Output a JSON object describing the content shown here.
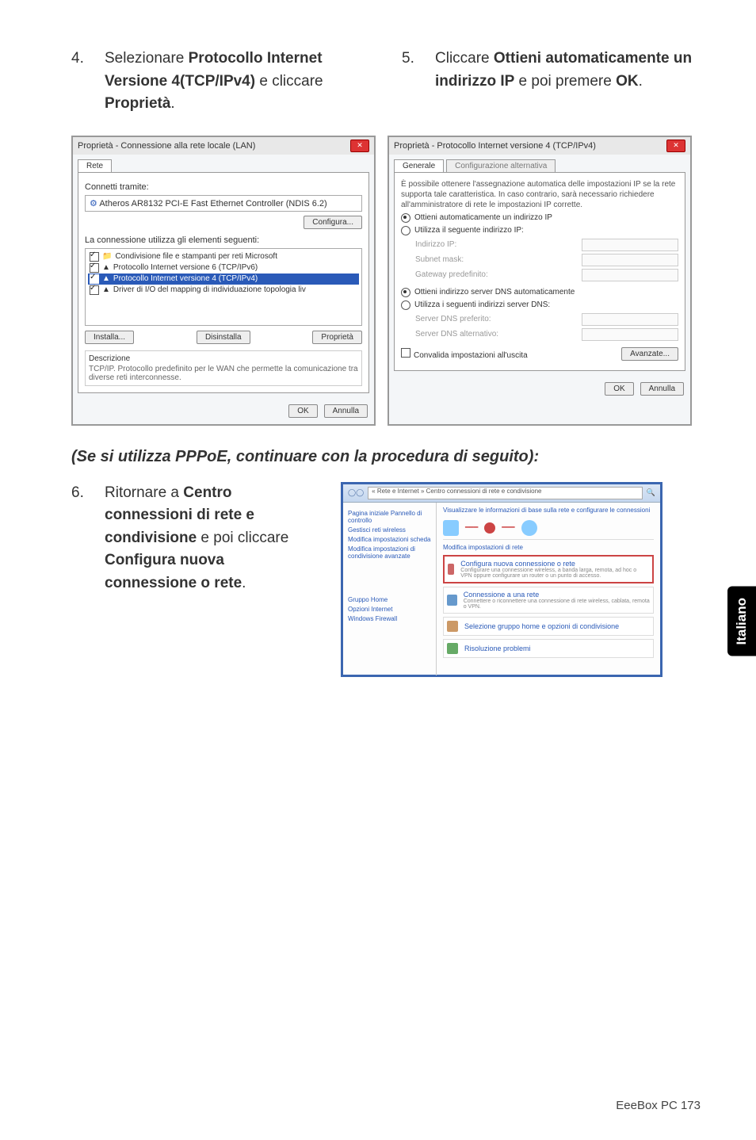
{
  "steps": {
    "s4": {
      "num": "4.",
      "text_pre": "Selezionare ",
      "b1": "Protocollo Internet Versione 4(TCP/IPv4)",
      "text_mid": " e cliccare ",
      "b2": "Proprietà",
      "text_end": "."
    },
    "s5": {
      "num": "5.",
      "text_pre": "Cliccare ",
      "b1": "Ottieni automaticamente un indirizzo IP",
      "text_mid": " e poi premere ",
      "b2": "OK",
      "text_end": "."
    },
    "s6": {
      "num": "6.",
      "text_pre": "Ritornare a ",
      "b1": "Centro connessioni di rete e condivisione",
      "text_mid": " e poi cliccare ",
      "b2": "Configura nuova connessione o rete",
      "text_end": "."
    }
  },
  "pppoe": "(Se si utilizza PPPoE, continuare con la procedura di seguito):",
  "dlg1": {
    "title": "Proprietà - Connessione alla rete locale (LAN)",
    "tab": "Rete",
    "connect_lbl": "Connetti tramite:",
    "adapter": "Atheros AR8132 PCI-E Fast Ethernet Controller (NDIS 6.2)",
    "configure": "Configura...",
    "uses_lbl": "La connessione utilizza gli elementi seguenti:",
    "items": [
      "Condivisione file e stampanti per reti Microsoft",
      "Protocollo Internet versione 6 (TCP/IPv6)",
      "Protocollo Internet versione 4 (TCP/IPv4)",
      "Driver di I/O del mapping di individuazione topologia liv"
    ],
    "install": "Installa...",
    "uninstall": "Disinstalla",
    "props": "Proprietà",
    "descr_title": "Descrizione",
    "descr": "TCP/IP. Protocollo predefinito per le WAN che permette la comunicazione tra diverse reti interconnesse.",
    "ok": "OK",
    "cancel": "Annulla"
  },
  "dlg2": {
    "title": "Proprietà - Protocollo Internet versione 4 (TCP/IPv4)",
    "tab1": "Generale",
    "tab2": "Configurazione alternativa",
    "intro": "È possibile ottenere l'assegnazione automatica delle impostazioni IP se la rete supporta tale caratteristica. In caso contrario, sarà necessario richiedere all'amministratore di rete le impostazioni IP corrette.",
    "r1": "Ottieni automaticamente un indirizzo IP",
    "r2": "Utilizza il seguente indirizzo IP:",
    "ip": "Indirizzo IP:",
    "mask": "Subnet mask:",
    "gw": "Gateway predefinito:",
    "r3": "Ottieni indirizzo server DNS automaticamente",
    "r4": "Utilizza i seguenti indirizzi server DNS:",
    "dns1": "Server DNS preferito:",
    "dns2": "Server DNS alternativo:",
    "validate": "Convalida impostazioni all'uscita",
    "adv": "Avanzate...",
    "ok": "OK",
    "cancel": "Annulla"
  },
  "shot3": {
    "addr": "« Rete e Internet » Centro connessioni di rete e condivisione",
    "title": "Visualizzare le informazioni di base sulla rete e configurare le connessioni",
    "sidelinks": [
      "Pagina iniziale Pannello di controllo",
      "Gestisci reti wireless",
      "Modifica impostazioni scheda",
      "Modifica impostazioni di condivisione avanzate"
    ],
    "sidelinks2": [
      "Gruppo Home",
      "Opzioni Internet",
      "Windows Firewall"
    ],
    "row1": "Modifica impostazioni di rete",
    "row2": "Configura nuova connessione o rete",
    "row2d": "Configurare una connessione wireless, a banda larga, remota, ad hoc o VPN oppure configurare un router o un punto di accesso.",
    "row3": "Connessione a una rete",
    "row3d": "Connettere o riconnettere una connessione di rete wireless, cablata, remota o VPN.",
    "row4": "Selezione gruppo home e opzioni di condivisione",
    "row5": "Risoluzione problemi"
  },
  "sidetab": "Italiano",
  "footer": "EeeBox PC    173"
}
